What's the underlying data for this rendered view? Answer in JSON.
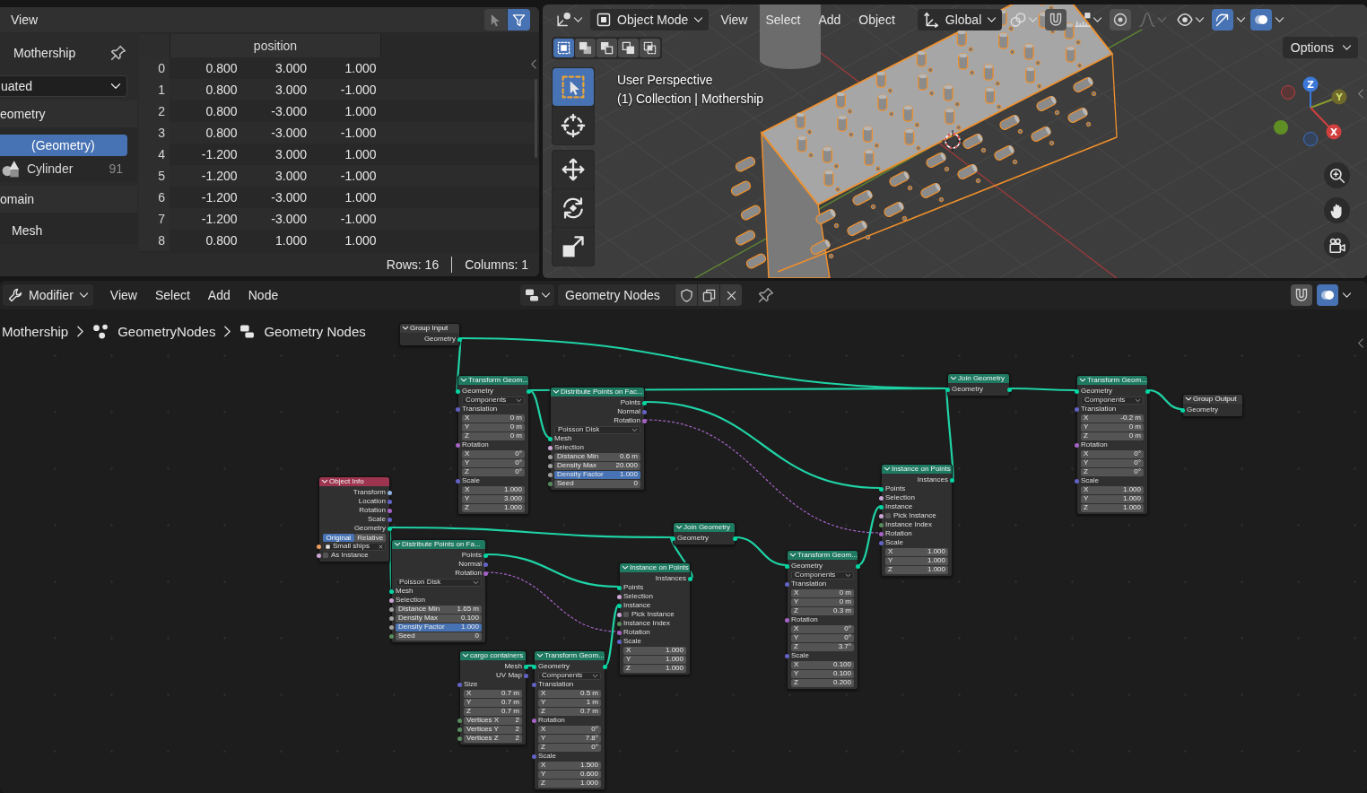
{
  "spreadsheet": {
    "menus": [
      "View"
    ],
    "toggles": [
      {
        "kind": "selection",
        "on": false
      },
      {
        "kind": "filter",
        "on": true
      }
    ],
    "sidebar": {
      "object": "Mothership",
      "evaluation": "uated",
      "sections": [
        {
          "heading": "eometry",
          "items": [
            {
              "label": "(Geometry)",
              "selected": true
            },
            {
              "kind": "instances",
              "label": "Cylinder",
              "count": "91",
              "selected": false
            }
          ]
        },
        {
          "heading": "omain",
          "items": [
            {
              "label": "Mesh",
              "selected": false
            }
          ]
        }
      ]
    },
    "table": {
      "columns": [
        "position"
      ],
      "rows": [
        {
          "index": "0",
          "values": [
            "0.800",
            "3.000",
            "1.000"
          ]
        },
        {
          "index": "1",
          "values": [
            "0.800",
            "3.000",
            "-1.000"
          ]
        },
        {
          "index": "2",
          "values": [
            "0.800",
            "-3.000",
            "1.000"
          ]
        },
        {
          "index": "3",
          "values": [
            "0.800",
            "-3.000",
            "-1.000"
          ]
        },
        {
          "index": "4",
          "values": [
            "-1.200",
            "3.000",
            "1.000"
          ]
        },
        {
          "index": "5",
          "values": [
            "-1.200",
            "3.000",
            "-1.000"
          ]
        },
        {
          "index": "6",
          "values": [
            "-1.200",
            "-3.000",
            "1.000"
          ]
        },
        {
          "index": "7",
          "values": [
            "-1.200",
            "-3.000",
            "-1.000"
          ]
        },
        {
          "index": "8",
          "values": [
            "0.800",
            "1.000",
            "1.000"
          ]
        }
      ]
    },
    "status": [
      "Rows: 16",
      "Columns: 1"
    ]
  },
  "viewport": {
    "header": {
      "controls": [
        {
          "kind": "editor"
        },
        {
          "kind": "mode",
          "label": "Object Mode"
        },
        {
          "kind": "menu",
          "label": "View"
        },
        {
          "kind": "menu",
          "label": "Select"
        },
        {
          "kind": "menu",
          "label": "Add"
        },
        {
          "kind": "menu",
          "label": "Object"
        },
        {
          "kind": "orientation",
          "label": "Global"
        },
        {
          "kind": "pivot"
        },
        {
          "kind": "snap",
          "on": false
        },
        {
          "kind": "target"
        },
        {
          "kind": "proportional",
          "on": false
        },
        {
          "kind": "falloff",
          "disabled": true
        },
        {
          "kind": "visibility"
        },
        {
          "kind": "gizmos",
          "on": true
        },
        {
          "kind": "overlays",
          "on": true
        }
      ]
    },
    "select_modes": [
      {
        "kind": "set",
        "selected": true
      },
      {
        "kind": "extend",
        "selected": false
      },
      {
        "kind": "subtract",
        "selected": false
      },
      {
        "kind": "invert",
        "selected": false
      },
      {
        "kind": "intersect",
        "selected": false
      }
    ],
    "options": "Options",
    "toolbar": [
      {
        "tools": [
          {
            "kind": "select",
            "selected": true
          },
          {
            "kind": "cursor",
            "selected": false
          }
        ]
      },
      {
        "tools": [
          {
            "kind": "move",
            "selected": false
          },
          {
            "kind": "rotate",
            "selected": false
          },
          {
            "kind": "scale",
            "selected": false
          }
        ]
      }
    ],
    "view_name": "User Perspective",
    "collection": "(1) Collection | Mothership",
    "gizmo_axes": [
      "Z",
      "Y",
      "X"
    ]
  },
  "node_editor": {
    "header": {
      "editor": "Modifier",
      "menus": [
        "View",
        "Select",
        "Add",
        "Node"
      ],
      "tree": "Geometry Nodes",
      "toggles": [
        {
          "kind": "snap",
          "on": false
        },
        {
          "kind": "overlays",
          "on": true
        }
      ]
    },
    "breadcrumbs": [
      {
        "kind": "object",
        "label": "Mothership"
      },
      {
        "kind": "modifier",
        "label": "GeometryNodes"
      },
      {
        "kind": "tree",
        "label": "Geometry Nodes"
      }
    ],
    "nodes": [
      {
        "title": "Group Input",
        "kind": "group",
        "rows": [
          {
            "kind": "output",
            "label": "Geometry",
            "color": "#00d6a3"
          }
        ]
      },
      {
        "title": "Transform Geom...",
        "kind": "geometry",
        "rows": [
          {
            "kind": "through",
            "label": "Geometry",
            "color": "#00d6a3"
          },
          {
            "kind": "dropdown",
            "label": "Components"
          },
          {
            "kind": "label",
            "label": "Translation",
            "color": "#6363c7"
          },
          {
            "kind": "field",
            "label": "X",
            "value": "0 m"
          },
          {
            "kind": "field",
            "label": "Y",
            "value": "0 m"
          },
          {
            "kind": "field",
            "label": "Z",
            "value": "0 m"
          },
          {
            "kind": "label",
            "label": "Rotation",
            "color": "#a663c7"
          },
          {
            "kind": "field",
            "label": "X",
            "value": "0°"
          },
          {
            "kind": "field",
            "label": "Y",
            "value": "0°"
          },
          {
            "kind": "field",
            "label": "Z",
            "value": "0°"
          },
          {
            "kind": "label",
            "label": "Scale",
            "color": "#6363c7"
          },
          {
            "kind": "field",
            "label": "X",
            "value": "1.000"
          },
          {
            "kind": "field",
            "label": "Y",
            "value": "3.000"
          },
          {
            "kind": "field",
            "label": "Z",
            "value": "1.000"
          }
        ]
      },
      {
        "title": "Distribute Points on Fac...",
        "kind": "geometry",
        "rows": [
          {
            "kind": "output",
            "label": "Points",
            "color": "#00d6a3"
          },
          {
            "kind": "output",
            "label": "Normal",
            "color": "#6363c7"
          },
          {
            "kind": "output",
            "label": "Rotation",
            "color": "#a663c7"
          },
          {
            "kind": "dropdown",
            "label": "Poisson Disk"
          },
          {
            "kind": "input",
            "label": "Mesh",
            "color": "#00d6a3"
          },
          {
            "kind": "input",
            "label": "Selection",
            "color": "#cca6d6"
          },
          {
            "kind": "field",
            "label": "Distance Min",
            "value": "0.6 m",
            "color": "#a1a1a1"
          },
          {
            "kind": "field",
            "label": "Density Max",
            "value": "20.000",
            "color": "#a1a1a1"
          },
          {
            "kind": "slider",
            "label": "Density Factor",
            "value": "1.000",
            "level": 1,
            "color": "#a1a1a1"
          },
          {
            "kind": "field",
            "label": "Seed",
            "value": "0",
            "color": "#598c5c"
          }
        ]
      },
      {
        "title": "Object Info",
        "kind": "input",
        "rows": [
          {
            "kind": "output",
            "label": "Transform",
            "color": "#8fb0e0"
          },
          {
            "kind": "output",
            "label": "Location",
            "color": "#6363c7"
          },
          {
            "kind": "output",
            "label": "Rotation",
            "color": "#a663c7"
          },
          {
            "kind": "output",
            "label": "Scale",
            "color": "#6363c7"
          },
          {
            "kind": "output",
            "label": "Geometry",
            "color": "#00d6a3"
          },
          {
            "kind": "toggle",
            "options": [
              {
                "label": "Original",
                "selected": true
              },
              {
                "label": "Relative",
                "selected": false
              }
            ]
          },
          {
            "kind": "object",
            "label": "Small ships",
            "color": "#ed9e5c"
          },
          {
            "kind": "checkbox",
            "label": "As Instance",
            "checked": false,
            "color": "#cca6d6"
          }
        ]
      },
      {
        "title": "Distribute Points on Fa...",
        "kind": "geometry",
        "rows": [
          {
            "kind": "output",
            "label": "Points",
            "color": "#00d6a3"
          },
          {
            "kind": "output",
            "label": "Normal",
            "color": "#6363c7"
          },
          {
            "kind": "output",
            "label": "Rotation",
            "color": "#a663c7"
          },
          {
            "kind": "dropdown",
            "label": "Poisson Disk"
          },
          {
            "kind": "input",
            "label": "Mesh",
            "color": "#00d6a3"
          },
          {
            "kind": "input",
            "label": "Selection",
            "color": "#cca6d6"
          },
          {
            "kind": "field",
            "label": "Distance Min",
            "value": "1.65 m",
            "color": "#a1a1a1"
          },
          {
            "kind": "field",
            "label": "Density Max",
            "value": "0.100",
            "color": "#a1a1a1"
          },
          {
            "kind": "slider",
            "label": "Density Factor",
            "value": "1.000",
            "level": 1,
            "color": "#a1a1a1"
          },
          {
            "kind": "field",
            "label": "Seed",
            "value": "0",
            "color": "#598c5c"
          }
        ]
      },
      {
        "title": "Join Geometry",
        "kind": "geometry",
        "rows": [
          {
            "kind": "through",
            "label": "Geometry",
            "color": "#00d6a3"
          }
        ]
      },
      {
        "title": "Instance on Points",
        "kind": "geometry",
        "rows": [
          {
            "kind": "output",
            "label": "Instances",
            "color": "#00d6a3"
          },
          {
            "kind": "input",
            "label": "Points",
            "color": "#00d6a3"
          },
          {
            "kind": "input",
            "label": "Selection",
            "color": "#cca6d6"
          },
          {
            "kind": "input",
            "label": "Instance",
            "color": "#00d6a3"
          },
          {
            "kind": "checkbox",
            "label": "Pick Instance",
            "checked": false,
            "color": "#cca6d6"
          },
          {
            "kind": "input",
            "label": "Instance Index",
            "color": "#598c5c"
          },
          {
            "kind": "input",
            "label": "Rotation",
            "color": "#a663c7"
          },
          {
            "kind": "label",
            "label": "Scale",
            "color": "#6363c7"
          },
          {
            "kind": "field",
            "label": "X",
            "value": "1.000"
          },
          {
            "kind": "field",
            "label": "Y",
            "value": "1.000"
          },
          {
            "kind": "field",
            "label": "Z",
            "value": "1.000"
          }
        ]
      },
      {
        "title": "cargo containers",
        "kind": "geometry",
        "rows": [
          {
            "kind": "output",
            "label": "Mesh",
            "color": "#00d6a3"
          },
          {
            "kind": "output",
            "label": "UV Map",
            "color": "#6363c7"
          },
          {
            "kind": "label",
            "label": "Size",
            "color": "#6363c7"
          },
          {
            "kind": "field",
            "label": "X",
            "value": "0.7 m"
          },
          {
            "kind": "field",
            "label": "Y",
            "value": "0.7 m"
          },
          {
            "kind": "field",
            "label": "Z",
            "value": "0.7 m"
          },
          {
            "kind": "field",
            "label": "Vertices X",
            "value": "2",
            "color": "#598c5c"
          },
          {
            "kind": "field",
            "label": "Vertices Y",
            "value": "2",
            "color": "#598c5c"
          },
          {
            "kind": "field",
            "label": "Vertices Z",
            "value": "2",
            "color": "#598c5c"
          }
        ]
      },
      {
        "title": "Transform Geom...",
        "kind": "geometry",
        "rows": [
          {
            "kind": "through",
            "label": "Geometry",
            "color": "#00d6a3"
          },
          {
            "kind": "dropdown",
            "label": "Components"
          },
          {
            "kind": "label",
            "label": "Translation",
            "color": "#6363c7"
          },
          {
            "kind": "field",
            "label": "X",
            "value": "0.5 m"
          },
          {
            "kind": "field",
            "label": "Y",
            "value": "1 m"
          },
          {
            "kind": "field",
            "label": "Z",
            "value": "0.7 m"
          },
          {
            "kind": "label",
            "label": "Rotation",
            "color": "#a663c7"
          },
          {
            "kind": "field",
            "label": "X",
            "value": "0°"
          },
          {
            "kind": "field",
            "label": "Y",
            "value": "7.8°"
          },
          {
            "kind": "field",
            "label": "Z",
            "value": "0°"
          },
          {
            "kind": "label",
            "label": "Scale",
            "color": "#6363c7"
          },
          {
            "kind": "field",
            "label": "X",
            "value": "1.500"
          },
          {
            "kind": "field",
            "label": "Y",
            "value": "0.600"
          },
          {
            "kind": "field",
            "label": "Z",
            "value": "1.000"
          }
        ]
      },
      {
        "title": "Transform Geom...",
        "kind": "geometry",
        "rows": [
          {
            "kind": "through",
            "label": "Geometry",
            "color": "#00d6a3"
          },
          {
            "kind": "dropdown",
            "label": "Components"
          },
          {
            "kind": "label",
            "label": "Translation",
            "color": "#6363c7"
          },
          {
            "kind": "field",
            "label": "X",
            "value": "0 m"
          },
          {
            "kind": "field",
            "label": "Y",
            "value": "0 m"
          },
          {
            "kind": "field",
            "label": "Z",
            "value": "0.3 m"
          },
          {
            "kind": "label",
            "label": "Rotation",
            "color": "#a663c7"
          },
          {
            "kind": "field",
            "label": "X",
            "value": "0°"
          },
          {
            "kind": "field",
            "label": "Y",
            "value": "0°"
          },
          {
            "kind": "field",
            "label": "Z",
            "value": "3.7°"
          },
          {
            "kind": "label",
            "label": "Scale",
            "color": "#6363c7"
          },
          {
            "kind": "field",
            "label": "X",
            "value": "0.100"
          },
          {
            "kind": "field",
            "label": "Y",
            "value": "0.100"
          },
          {
            "kind": "field",
            "label": "Z",
            "value": "0.200"
          }
        ]
      },
      {
        "title": "Instance on Points",
        "kind": "geometry",
        "rows": [
          {
            "kind": "output",
            "label": "Instances",
            "color": "#00d6a3"
          },
          {
            "kind": "input",
            "label": "Points",
            "color": "#00d6a3"
          },
          {
            "kind": "input",
            "label": "Selection",
            "color": "#cca6d6"
          },
          {
            "kind": "input",
            "label": "Instance",
            "color": "#00d6a3"
          },
          {
            "kind": "checkbox",
            "label": "Pick Instance",
            "checked": false,
            "color": "#cca6d6"
          },
          {
            "kind": "input",
            "label": "Instance Index",
            "color": "#598c5c"
          },
          {
            "kind": "input",
            "label": "Rotation",
            "color": "#a663c7"
          },
          {
            "kind": "label",
            "label": "Scale",
            "color": "#6363c7"
          },
          {
            "kind": "field",
            "label": "X",
            "value": "1.000"
          },
          {
            "kind": "field",
            "label": "Y",
            "value": "1.000"
          },
          {
            "kind": "field",
            "label": "Z",
            "value": "1.000"
          }
        ]
      },
      {
        "title": "Join Geometry",
        "kind": "geometry",
        "rows": [
          {
            "kind": "through",
            "label": "Geometry",
            "color": "#00d6a3"
          }
        ]
      },
      {
        "title": "Transform Geom...",
        "kind": "geometry",
        "rows": [
          {
            "kind": "through",
            "label": "Geometry",
            "color": "#00d6a3"
          },
          {
            "kind": "dropdown",
            "label": "Components"
          },
          {
            "kind": "label",
            "label": "Translation",
            "color": "#6363c7"
          },
          {
            "kind": "field",
            "label": "X",
            "value": "-0.2 m"
          },
          {
            "kind": "field",
            "label": "Y",
            "value": "0 m"
          },
          {
            "kind": "field",
            "label": "Z",
            "value": "0 m"
          },
          {
            "kind": "label",
            "label": "Rotation",
            "color": "#a663c7"
          },
          {
            "kind": "field",
            "label": "X",
            "value": "0°"
          },
          {
            "kind": "field",
            "label": "Y",
            "value": "0°"
          },
          {
            "kind": "field",
            "label": "Z",
            "value": "0°"
          },
          {
            "kind": "label",
            "label": "Scale",
            "color": "#6363c7"
          },
          {
            "kind": "field",
            "label": "X",
            "value": "1.000"
          },
          {
            "kind": "field",
            "label": "Y",
            "value": "1.000"
          },
          {
            "kind": "field",
            "label": "Z",
            "value": "1.000"
          }
        ]
      },
      {
        "title": "Group Output",
        "kind": "group",
        "rows": [
          {
            "kind": "input",
            "label": "Geometry",
            "color": "#00d6a3"
          }
        ]
      }
    ]
  }
}
